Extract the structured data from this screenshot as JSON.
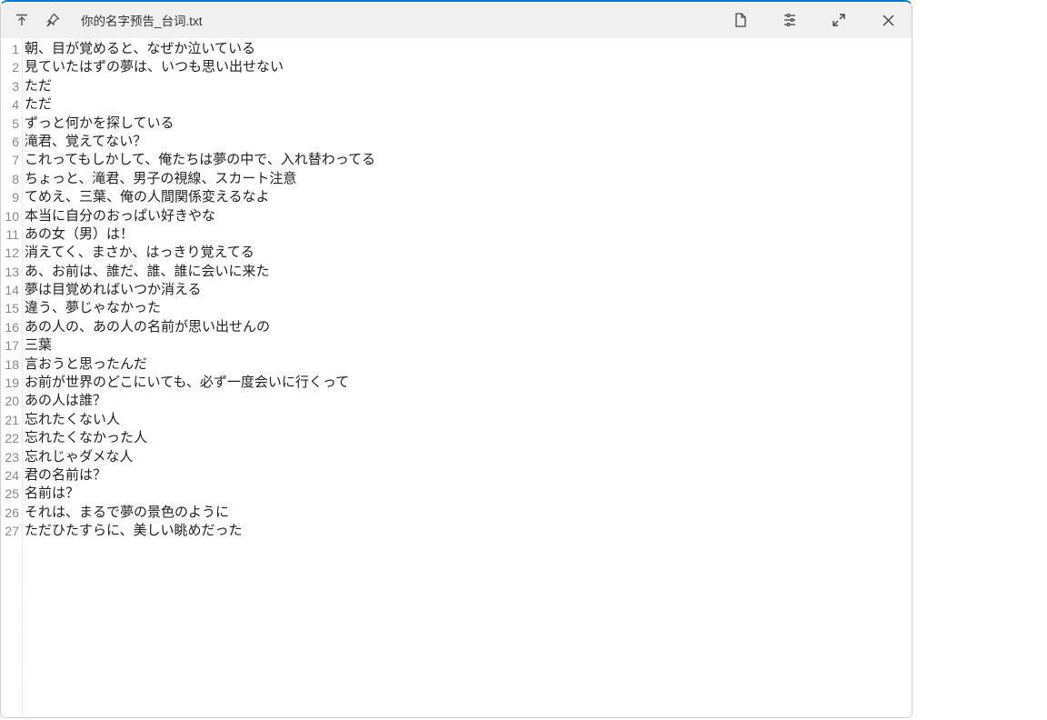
{
  "titlebar": {
    "title": "你的名字预告_台词.txt",
    "icons": {
      "top": "top-icon",
      "pin": "pin-icon",
      "newfile": "new-file-icon",
      "settings": "settings-icon",
      "maximize": "maximize-icon",
      "close": "close-icon"
    }
  },
  "editor": {
    "lines": [
      "朝、目が覚めると、なぜか泣いている",
      "見ていたはずの夢は、いつも思い出せない",
      "ただ",
      "ただ",
      "ずっと何かを探している",
      "滝君、覚えてない？",
      "これってもしかして、俺たちは夢の中で、入れ替わってる",
      "ちょっと、滝君、男子の視線、スカート注意",
      "てめえ、三葉、俺の人間関係変えるなよ",
      "本当に自分のおっぱい好きやな",
      "あの女（男）は！",
      "消えてく、まさか、はっきり覚えてる",
      "あ、お前は、誰だ、誰、誰に会いに来た",
      "夢は目覚めればいつか消える",
      "違う、夢じゃなかった",
      "あの人の、あの人の名前が思い出せんの",
      "三葉",
      "言おうと思ったんだ",
      "お前が世界のどこにいても、必ず一度会いに行くって",
      "あの人は誰？",
      "忘れたくない人",
      "忘れたくなかった人",
      "忘れじゃダメな人",
      "君の名前は？",
      "名前は？",
      "それは、まるで夢の景色のように",
      "ただひたすらに、美しい眺めだった"
    ]
  }
}
